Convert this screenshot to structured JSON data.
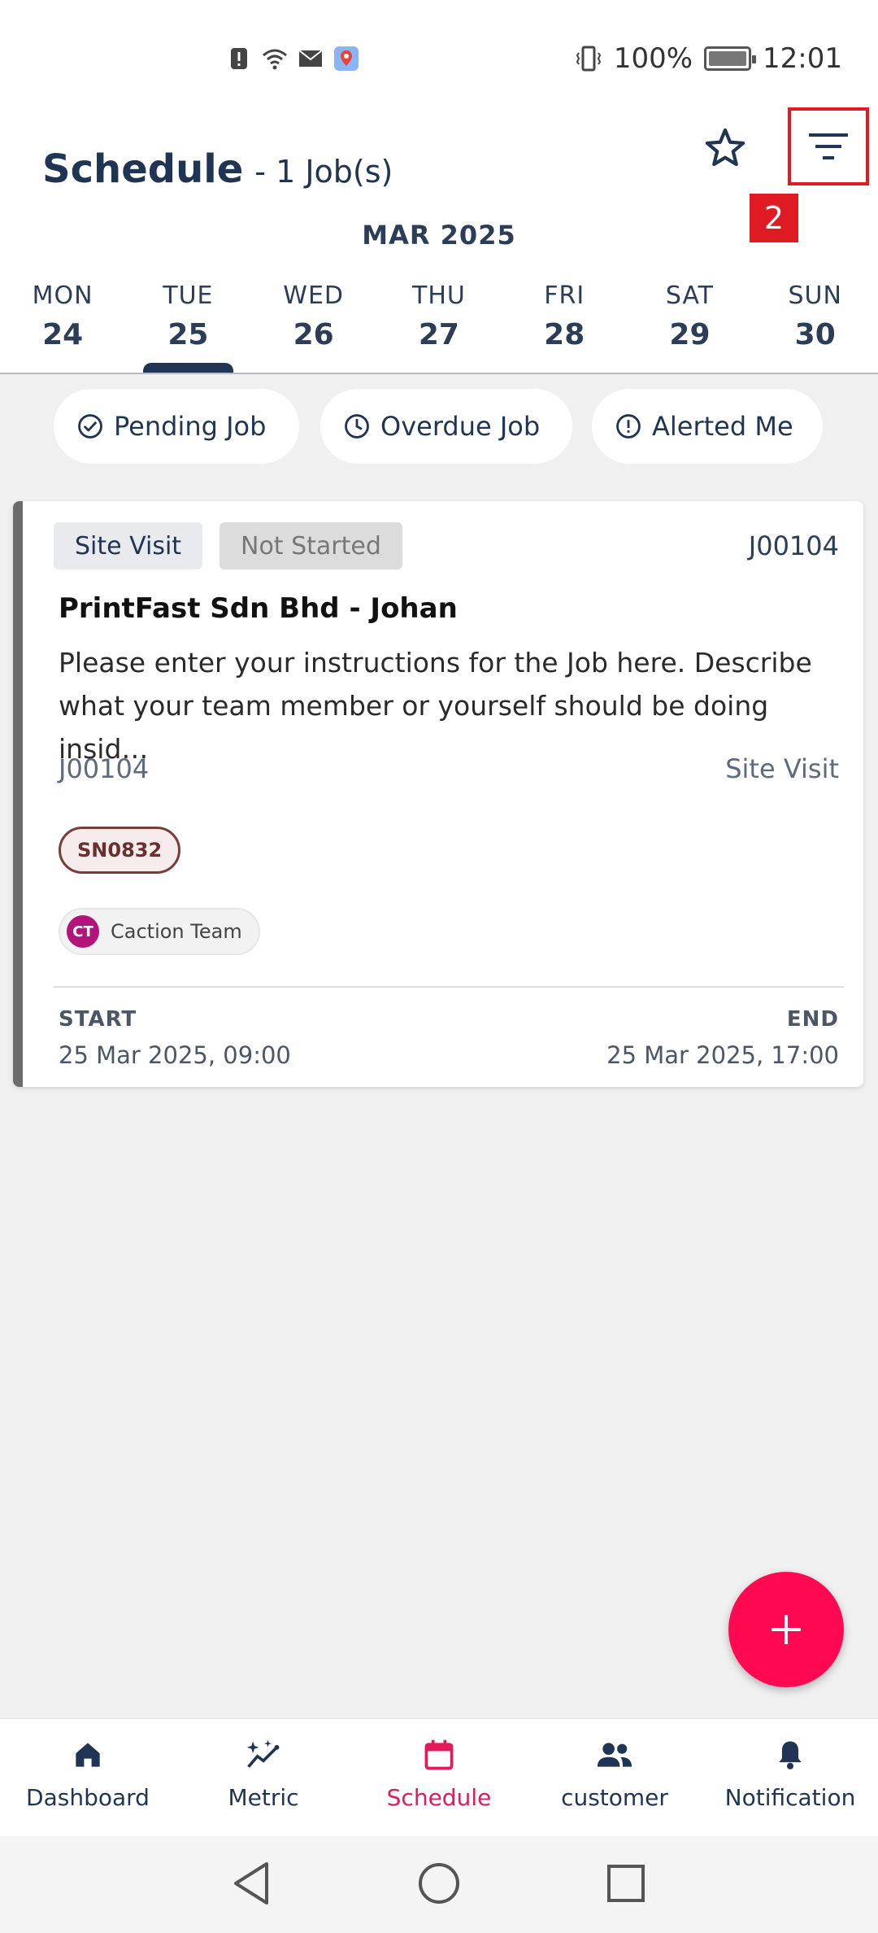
{
  "status_bar": {
    "battery_percent": "100%",
    "time": "12:01",
    "icons": [
      "alert-icon",
      "wifi-icon",
      "mail-icon",
      "maps-icon",
      "vibrate-icon",
      "battery-icon"
    ]
  },
  "header": {
    "title": "Schedule",
    "subtitle": "- 1 Job(s)",
    "annotation_badge": "2",
    "month": "MAR 2025",
    "days": [
      {
        "name": "MON",
        "date": "24"
      },
      {
        "name": "TUE",
        "date": "25"
      },
      {
        "name": "WED",
        "date": "26"
      },
      {
        "name": "THU",
        "date": "27"
      },
      {
        "name": "FRI",
        "date": "28"
      },
      {
        "name": "SAT",
        "date": "29"
      },
      {
        "name": "SUN",
        "date": "30"
      }
    ],
    "selected_day": "25"
  },
  "chips": {
    "pending": "Pending Job",
    "overdue": "Overdue Job",
    "alerted": "Alerted Me"
  },
  "job_card": {
    "type_tag": "Site Visit",
    "status_tag": "Not Started",
    "job_id": "J00104",
    "customer": "PrintFast Sdn Bhd - Johan",
    "description": "Please enter your instructions for the Job here. Describe what your team member or yourself should be doing insid…",
    "job_id_secondary": "J00104",
    "type_secondary": "Site Visit",
    "serial_number": "SN0832",
    "team_initials": "CT",
    "team_name": "Caction Team",
    "start_label": "START",
    "start_value": "25 Mar 2025, 09:00",
    "end_label": "END",
    "end_value": "25 Mar 2025, 17:00"
  },
  "bottom_nav": {
    "items": [
      {
        "label": "Dashboard",
        "icon": "home-icon"
      },
      {
        "label": "Metric",
        "icon": "sparkle-chart-icon"
      },
      {
        "label": "Schedule",
        "icon": "calendar-icon"
      },
      {
        "label": "customer",
        "icon": "people-icon"
      },
      {
        "label": "Notification",
        "icon": "bell-icon"
      }
    ],
    "active": "Schedule"
  },
  "colors": {
    "primary": "#1f3553",
    "accent": "#ff0a52",
    "active_nav": "#e3195c",
    "annotation_red": "#e01b24"
  }
}
